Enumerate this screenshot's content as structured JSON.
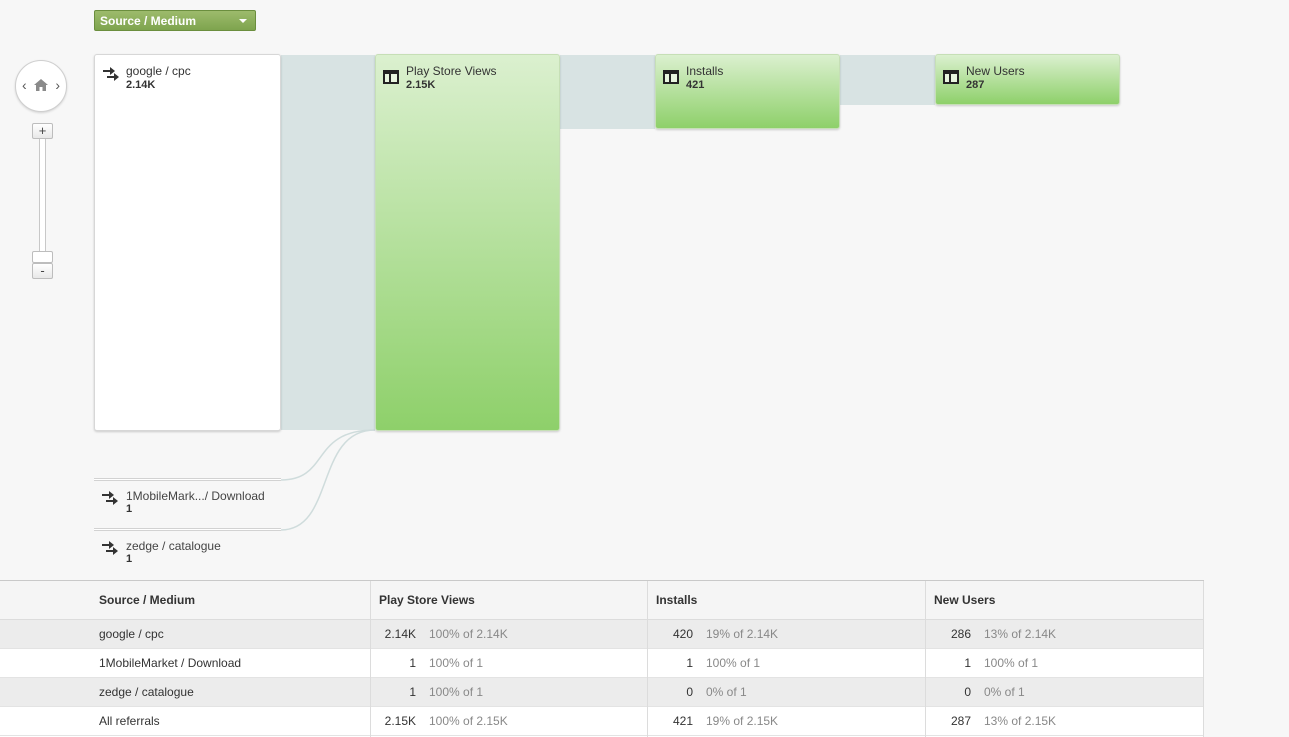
{
  "dimension_selector": {
    "label": "Source / Medium"
  },
  "source_nodes": [
    {
      "label": "google / cpc",
      "value": "2.14K"
    },
    {
      "label": "1MobileMark.../ Download",
      "value": "1"
    },
    {
      "label": "zedge / catalogue",
      "value": "1"
    }
  ],
  "steps": [
    {
      "label": "Play Store Views",
      "value": "2.15K"
    },
    {
      "label": "Installs",
      "value": "421"
    },
    {
      "label": "New Users",
      "value": "287"
    }
  ],
  "table": {
    "headers": [
      "Source / Medium",
      "Play Store Views",
      "Installs",
      "New Users"
    ],
    "rows": [
      {
        "name": "google / cpc",
        "views": "2.14K",
        "views_pct": "100% of 2.14K",
        "installs": "420",
        "installs_pct": "19% of 2.14K",
        "users": "286",
        "users_pct": "13% of 2.14K"
      },
      {
        "name": "1MobileMarket / Download",
        "views": "1",
        "views_pct": "100% of 1",
        "installs": "1",
        "installs_pct": "100% of 1",
        "users": "1",
        "users_pct": "100% of 1"
      },
      {
        "name": "zedge / catalogue",
        "views": "1",
        "views_pct": "100% of 1",
        "installs": "0",
        "installs_pct": "0% of 1",
        "users": "0",
        "users_pct": "0% of 1"
      },
      {
        "name": "All referrals",
        "views": "2.15K",
        "views_pct": "100% of 2.15K",
        "installs": "421",
        "installs_pct": "19% of 2.15K",
        "users": "287",
        "users_pct": "13% of 2.15K"
      }
    ]
  },
  "icons": {
    "source": "arrow-right-icon",
    "step": "page-layout-icon",
    "nav_home": "home-icon"
  },
  "colors": {
    "dropdown": "#86aa55",
    "step_top": "#dbf0cf",
    "step_bottom": "#8ed06a",
    "connector": "#d8e3e3"
  }
}
